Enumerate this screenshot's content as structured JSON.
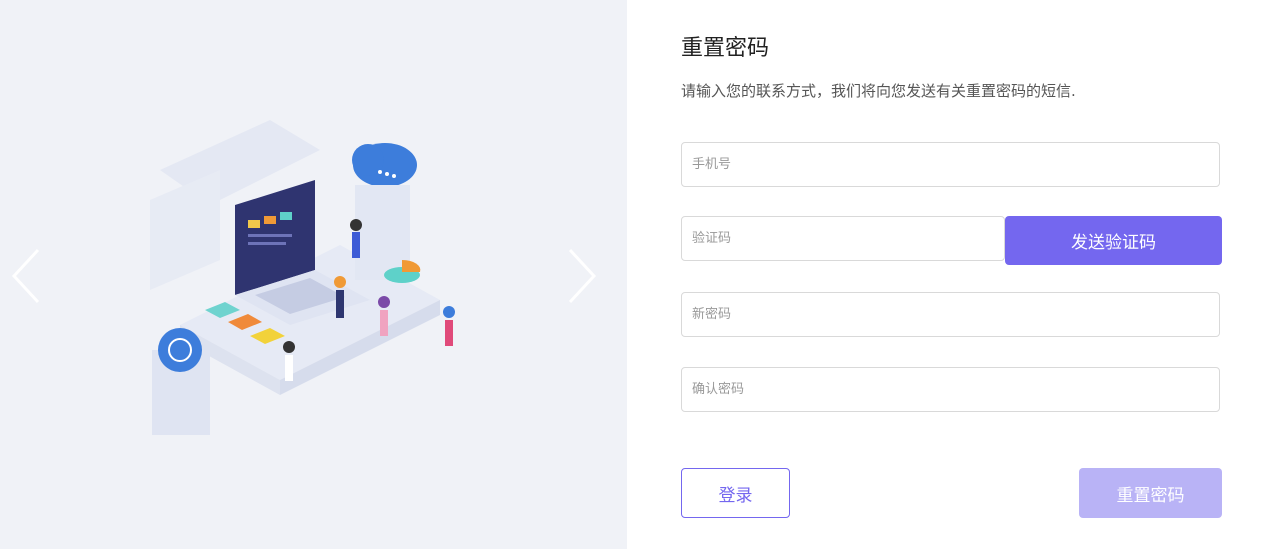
{
  "carousel": {
    "prev_icon": "chevron-left-icon",
    "next_icon": "chevron-right-icon",
    "illustration": "isometric-tech-illustration"
  },
  "form": {
    "title": "重置密码",
    "subtitle": "请输入您的联系方式，我们将向您发送有关重置密码的短信.",
    "phone_placeholder": "手机号",
    "code_placeholder": "验证码",
    "send_code_label": "发送验证码",
    "new_password_placeholder": "新密码",
    "confirm_password_placeholder": "确认密码",
    "login_label": "登录",
    "reset_label": "重置密码"
  },
  "colors": {
    "accent": "#7467ef",
    "accent_disabled": "#b9b3f6",
    "left_bg": "#f0f2f7"
  }
}
